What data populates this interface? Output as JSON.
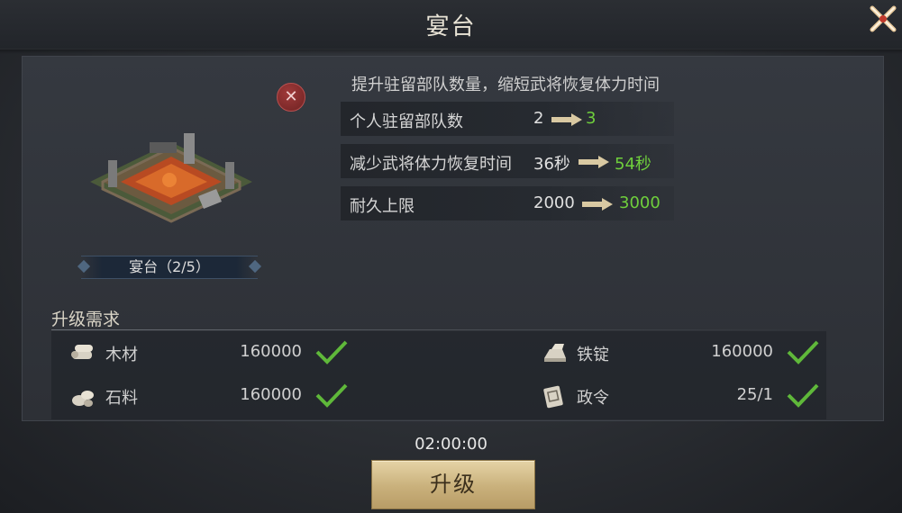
{
  "header": {
    "title": "宴台"
  },
  "building": {
    "name_label": "宴台（2/5）"
  },
  "upgrade_info": {
    "description": "提升驻留部队数量，缩短武将恢复体力时间",
    "stats": [
      {
        "label": "个人驻留部队数",
        "current": "2",
        "next": "3"
      },
      {
        "label": "减少武将体力恢复时间",
        "current": "36秒",
        "next": "54秒"
      },
      {
        "label": "耐久上限",
        "current": "2000",
        "next": "3000"
      }
    ]
  },
  "requirements": {
    "title": "升级需求",
    "items": [
      {
        "icon": "wood-icon",
        "name": "木材",
        "amount": "160000",
        "met": true
      },
      {
        "icon": "iron-ingot-icon",
        "name": "铁锭",
        "amount": "160000",
        "met": true
      },
      {
        "icon": "stone-icon",
        "name": "石料",
        "amount": "160000",
        "met": true
      },
      {
        "icon": "decree-icon",
        "name": "政令",
        "amount": "25/1",
        "met": true
      }
    ]
  },
  "footer": {
    "timer": "02:00:00",
    "upgrade_label": "升级"
  },
  "colors": {
    "accent_green": "#6fcf3c",
    "check_green": "#5fb83a",
    "button_gold": "#c9b07b"
  }
}
